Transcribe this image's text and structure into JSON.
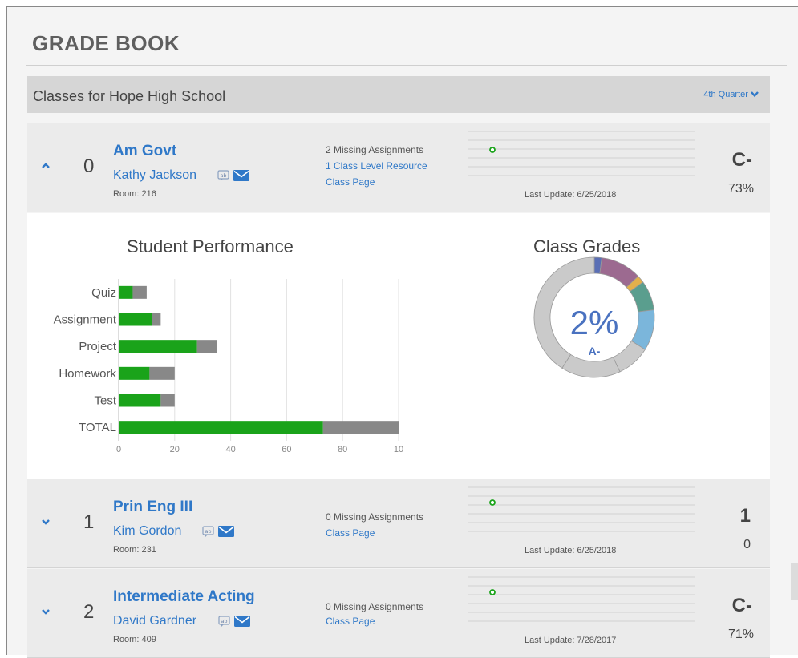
{
  "page_title": "GRADE BOOK",
  "classes_header": {
    "title": "Classes for Hope High School",
    "quarter": "4th Quarter"
  },
  "classes": [
    {
      "period": "0",
      "course": "Am Govt",
      "teacher": "Kathy Jackson",
      "room": "Room: 216",
      "missing": "2 Missing Assignments",
      "links": [
        "1 Class Level Resource",
        "Class Page"
      ],
      "last_update": "Last Update: 6/25/2018",
      "grade": "C-",
      "percent": "73%",
      "expanded": true
    },
    {
      "period": "1",
      "course": "Prin Eng III",
      "teacher": "Kim Gordon",
      "room": "Room: 231",
      "missing": "0 Missing Assignments",
      "links": [
        "Class Page"
      ],
      "last_update": "Last Update: 6/25/2018",
      "grade": "1",
      "percent": "0",
      "expanded": false
    },
    {
      "period": "2",
      "course": "Intermediate Acting",
      "teacher": "David Gardner",
      "room": "Room: 409",
      "missing": "0 Missing Assignments",
      "links": [
        "Class Page"
      ],
      "last_update": "Last Update: 7/28/2017",
      "grade": "C-",
      "percent": "71%",
      "expanded": false
    }
  ],
  "performance_title": "Student Performance",
  "class_grades_title": "Class Grades",
  "donut": {
    "center_percent": "2%",
    "center_grade": "A-"
  },
  "colors": {
    "link": "#2f78c8",
    "earned": "#1aa31a",
    "possible": "#888888",
    "donut_center": "#4a72c0"
  },
  "chart_data": [
    {
      "type": "bar",
      "orientation": "horizontal",
      "stacked": true,
      "categories": [
        "Quiz",
        "Assignment",
        "Project",
        "Homework",
        "Test",
        "TOTAL"
      ],
      "series": [
        {
          "values": [
            5,
            12,
            28,
            11,
            15,
            73
          ],
          "color": "#1aa31a"
        },
        {
          "values": [
            5,
            3,
            7,
            9,
            5,
            27
          ],
          "color": "#888888"
        }
      ],
      "xlim": [
        0,
        100
      ],
      "xticks": [
        "0",
        "20",
        "40",
        "60",
        "80",
        "10"
      ],
      "title": "Student Performance",
      "grid": true
    },
    {
      "type": "pie",
      "donut": true,
      "title": "Class Grades",
      "slices": [
        {
          "value": 2,
          "color": "#5a6fb5"
        },
        {
          "value": 11,
          "color": "#9c6a90"
        },
        {
          "value": 2,
          "color": "#e3b04b"
        },
        {
          "value": 8,
          "color": "#5a9e8e"
        },
        {
          "value": 11,
          "color": "#7bb6db"
        },
        {
          "value": 9,
          "color": "#cacaca"
        },
        {
          "value": 16,
          "color": "#cacaca"
        },
        {
          "value": 41,
          "color": "#cacaca"
        }
      ]
    }
  ]
}
